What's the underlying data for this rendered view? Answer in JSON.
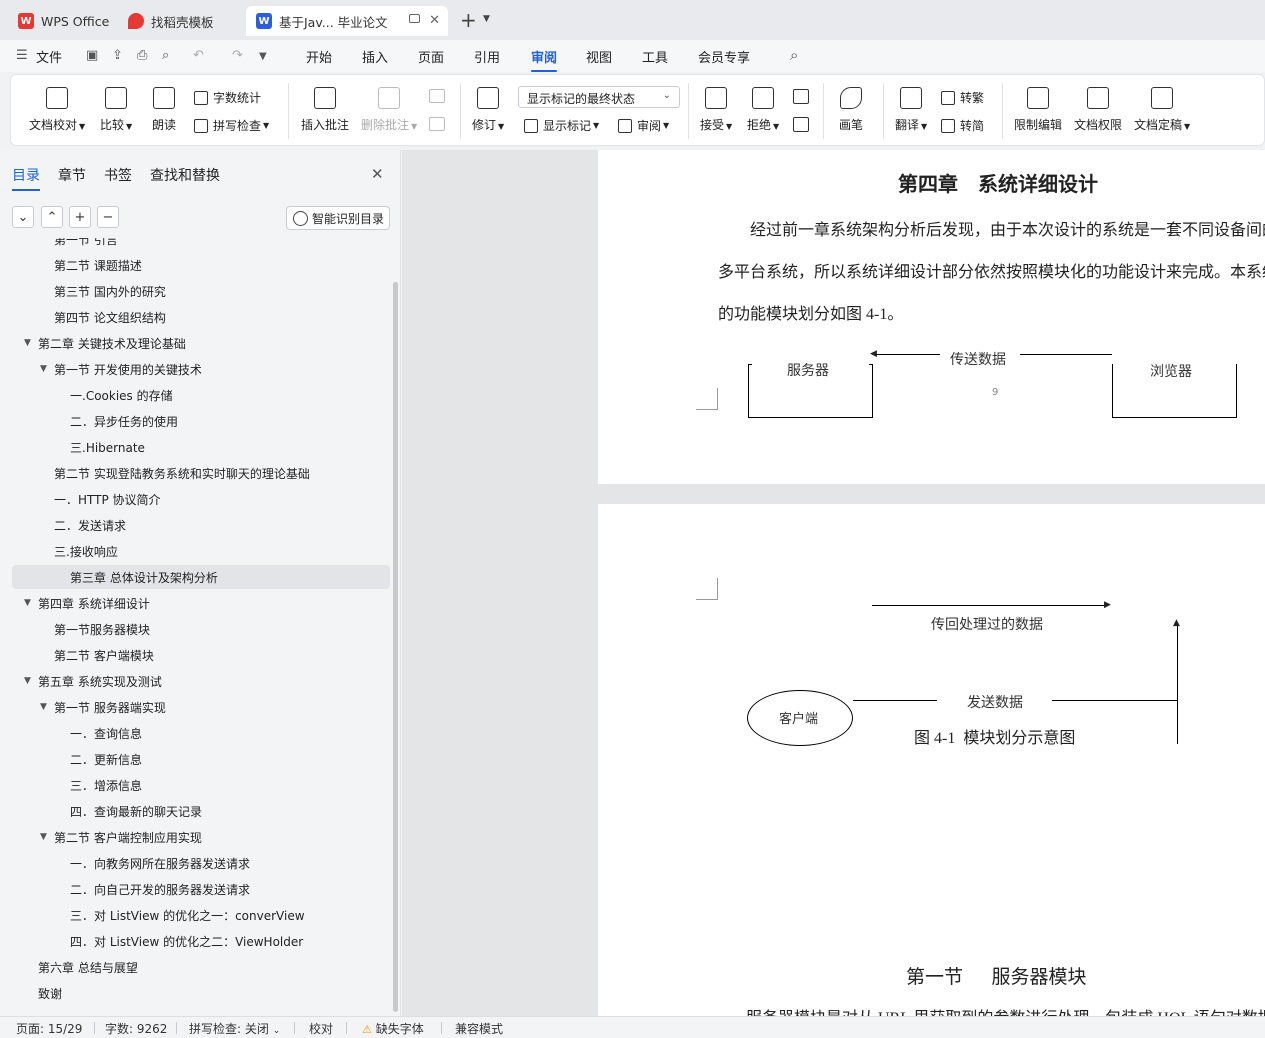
{
  "tabs": [
    {
      "label": "WPS Office",
      "icon": "wps-logo-icon"
    },
    {
      "label": "找稻壳模板",
      "icon": "docer-icon"
    },
    {
      "label": "基于Jav... 毕业论文",
      "icon": "word-doc-icon"
    }
  ],
  "menu": {
    "file": "文件",
    "items": [
      "开始",
      "插入",
      "页面",
      "引用",
      "审阅",
      "视图",
      "工具",
      "会员专享"
    ],
    "active": "审阅"
  },
  "ribbon": {
    "doc_check": "文档校对",
    "compare": "比较",
    "read_aloud": "朗读",
    "word_count": "字数统计",
    "spell_check": "拼写检查",
    "insert_comment": "插入批注",
    "delete_comment": "删除批注",
    "track": "修订",
    "mark_state": "显示标记的最终状态",
    "show_marks": "显示标记",
    "review": "审阅",
    "accept": "接受",
    "reject": "拒绝",
    "pen": "画笔",
    "translate": "翻译",
    "to_traditional": "转繁",
    "to_simplified": "转简",
    "restrict_edit": "限制编辑",
    "doc_permission": "文档权限",
    "finalize": "文档定稿"
  },
  "panel": {
    "tabs": [
      "目录",
      "章节",
      "书签",
      "查找和替换"
    ],
    "smart_toc": "智能识别目录",
    "buttons": [
      "⌄",
      "⌃",
      "+",
      "−"
    ]
  },
  "toc": [
    {
      "label": "第一节   引言",
      "level": 2
    },
    {
      "label": "第二节  课题描述",
      "level": 2
    },
    {
      "label": "第三节  国内外的研究",
      "level": 2
    },
    {
      "label": "第四节  论文组织结构",
      "level": 2
    },
    {
      "label": "第二章  关键技术及理论基础",
      "level": 1,
      "expanded": true
    },
    {
      "label": "第一节  开发使用的关键技术",
      "level": 2,
      "expanded": true
    },
    {
      "label": "一.Cookies 的存储",
      "level": 3
    },
    {
      "label": "二．异步任务的使用",
      "level": 3
    },
    {
      "label": "三.Hibernate",
      "level": 3
    },
    {
      "label": "第二节  实现登陆教务系统和实时聊天的理论基础",
      "level": 2
    },
    {
      "label": "一．HTTP 协议简介",
      "level": 2
    },
    {
      "label": "二．发送请求",
      "level": 2
    },
    {
      "label": "三.接收响应",
      "level": 2
    },
    {
      "label": "第三章  总体设计及架构分析",
      "level": 3,
      "selected": true
    },
    {
      "label": "第四章  系统详细设计",
      "level": 1,
      "expanded": true
    },
    {
      "label": "第一节服务器模块",
      "level": 2
    },
    {
      "label": "第二节  客户端模块",
      "level": 2
    },
    {
      "label": "第五章  系统实现及测试",
      "level": 1,
      "expanded": true
    },
    {
      "label": "第一节  服务器端实现",
      "level": 2,
      "expanded": true
    },
    {
      "label": "一．查询信息",
      "level": 3
    },
    {
      "label": "二．更新信息",
      "level": 3
    },
    {
      "label": "三．增添信息",
      "level": 3
    },
    {
      "label": "四．查询最新的聊天记录",
      "level": 3
    },
    {
      "label": "第二节  客户端控制应用实现",
      "level": 2,
      "expanded": true
    },
    {
      "label": "一．向教务网所在服务器发送请求",
      "level": 3
    },
    {
      "label": "二．向自己开发的服务器发送请求",
      "level": 3
    },
    {
      "label": "三．对 ListView 的优化之一：converView",
      "level": 3
    },
    {
      "label": "四．对 ListView 的优化之二：ViewHolder",
      "level": 3
    },
    {
      "label": "第六章  总结与展望",
      "level": 1
    },
    {
      "label": "致谢",
      "level": 1
    }
  ],
  "doc": {
    "chapter_title": "第四章    系统详细设计",
    "para_line1": "经过前一章系统架构分析后发现，由于本次设计的系统是一套不同设备间的",
    "para_line2": "多平台系统，所以系统详细设计部分依然按照模块化的功能设计来完成。本系统",
    "para_line3": "的功能模块划分如图 4-1。",
    "fig_server": "服务器",
    "fig_browser": "浏览器",
    "fig_send_data": "传送数据",
    "page_number": "9",
    "fig_return_data": "传回处理过的数据",
    "fig_client": "客户端",
    "fig_send": "发送数据",
    "fig_caption": "图 4-1  模块划分示意图",
    "section_title": "第一节      服务器模块",
    "section_para": "服务器模块是对从 URL 里获取到的参数进行处理，包装成 HQL 语句对数据"
  },
  "status": {
    "page": "页面: 15/29",
    "words": "字数: 9262",
    "spell": "拼写检查: 关闭",
    "proof": "校对",
    "missing_font": "缺失字体",
    "compat": "兼容模式"
  },
  "colors": {
    "accent": "#1e63d8",
    "wps_red": "#e53935",
    "word_blue": "#2b5fd9"
  }
}
